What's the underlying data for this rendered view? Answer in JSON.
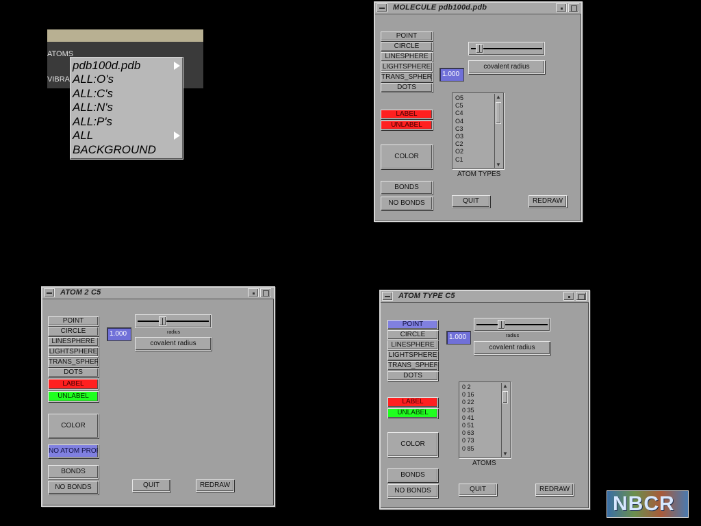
{
  "background_menu": {
    "tabs": [
      "ATOMS",
      "VIBRA"
    ],
    "items": [
      {
        "label": "pdb100d.pdb",
        "submenu": true
      },
      {
        "label": "ALL:O's",
        "submenu": false
      },
      {
        "label": "ALL:C's",
        "submenu": false
      },
      {
        "label": "ALL:N's",
        "submenu": false
      },
      {
        "label": "ALL:P's",
        "submenu": false
      },
      {
        "label": "ALL",
        "submenu": true
      },
      {
        "label": "BACKGROUND",
        "submenu": false
      }
    ]
  },
  "molecule_window": {
    "title": "MOLECULE pdb100d.pdb",
    "buttons": {
      "point": "POINT",
      "circle": "CIRCLE",
      "linesphere": "LINESPHERE",
      "lightsphere": "LIGHTSPHERE",
      "trans_sphere": "TRANS_SPHERE",
      "dots": "DOTS",
      "label": "LABEL",
      "unlabel": "UNLABEL",
      "color": "COLOR",
      "bonds": "BONDS",
      "no_bonds": "NO BONDS",
      "quit": "QUIT",
      "redraw": "REDRAW",
      "covalent_radius": "covalent radius"
    },
    "radius_value": "1.000",
    "slider_level": 0.07,
    "list_items": [
      "O5",
      "C5",
      "C4",
      "O4",
      "C3",
      "O3",
      "C2",
      "O2",
      "C1"
    ],
    "list_caption": "ATOM TYPES"
  },
  "atom_window": {
    "title": "ATOM  2 C5",
    "buttons": {
      "point": "POINT",
      "circle": "CIRCLE",
      "linesphere": "LINESPHERE",
      "lightsphere": "LIGHTSPHERE",
      "trans_sphere": "TRANS_SPHERE",
      "dots": "DOTS",
      "label": "LABEL",
      "unlabel": "UNLABEL",
      "color": "COLOR",
      "no_atom_prop": "NO ATOM PROP",
      "bonds": "BONDS",
      "no_bonds": "NO BONDS",
      "quit": "QUIT",
      "redraw": "REDRAW",
      "covalent_radius": "covalent radius"
    },
    "radius_value": "1.000",
    "slider_label": "radius",
    "slider_level": 0.33
  },
  "atom_type_window": {
    "title": "ATOM TYPE  C5",
    "buttons": {
      "point": "POINT",
      "circle": "CIRCLE",
      "linesphere": "LINESPHERE",
      "lightsphere": "LIGHTSPHERE",
      "trans_sphere": "TRANS_SPHERE",
      "dots": "DOTS",
      "label": "LABEL",
      "unlabel": "UNLABEL",
      "color": "COLOR",
      "bonds": "BONDS",
      "no_bonds": "NO BONDS",
      "quit": "QUIT",
      "redraw": "REDRAW",
      "covalent_radius": "covalent radius"
    },
    "radius_value": "1.000",
    "slider_label": "radius",
    "slider_level": 0.33,
    "list_items": [
      "0 2",
      "0 16",
      "0 22",
      "0 35",
      "0 41",
      "0 51",
      "0 63",
      "0 73",
      "0 85"
    ],
    "list_caption": "ATOMS"
  },
  "logo": {
    "text": "NBCR"
  },
  "colors": {
    "window": "#a0a0a0",
    "label_red": "#ff2020",
    "unlabel_green": "#20ff20",
    "field_blue": "#7070d8"
  }
}
